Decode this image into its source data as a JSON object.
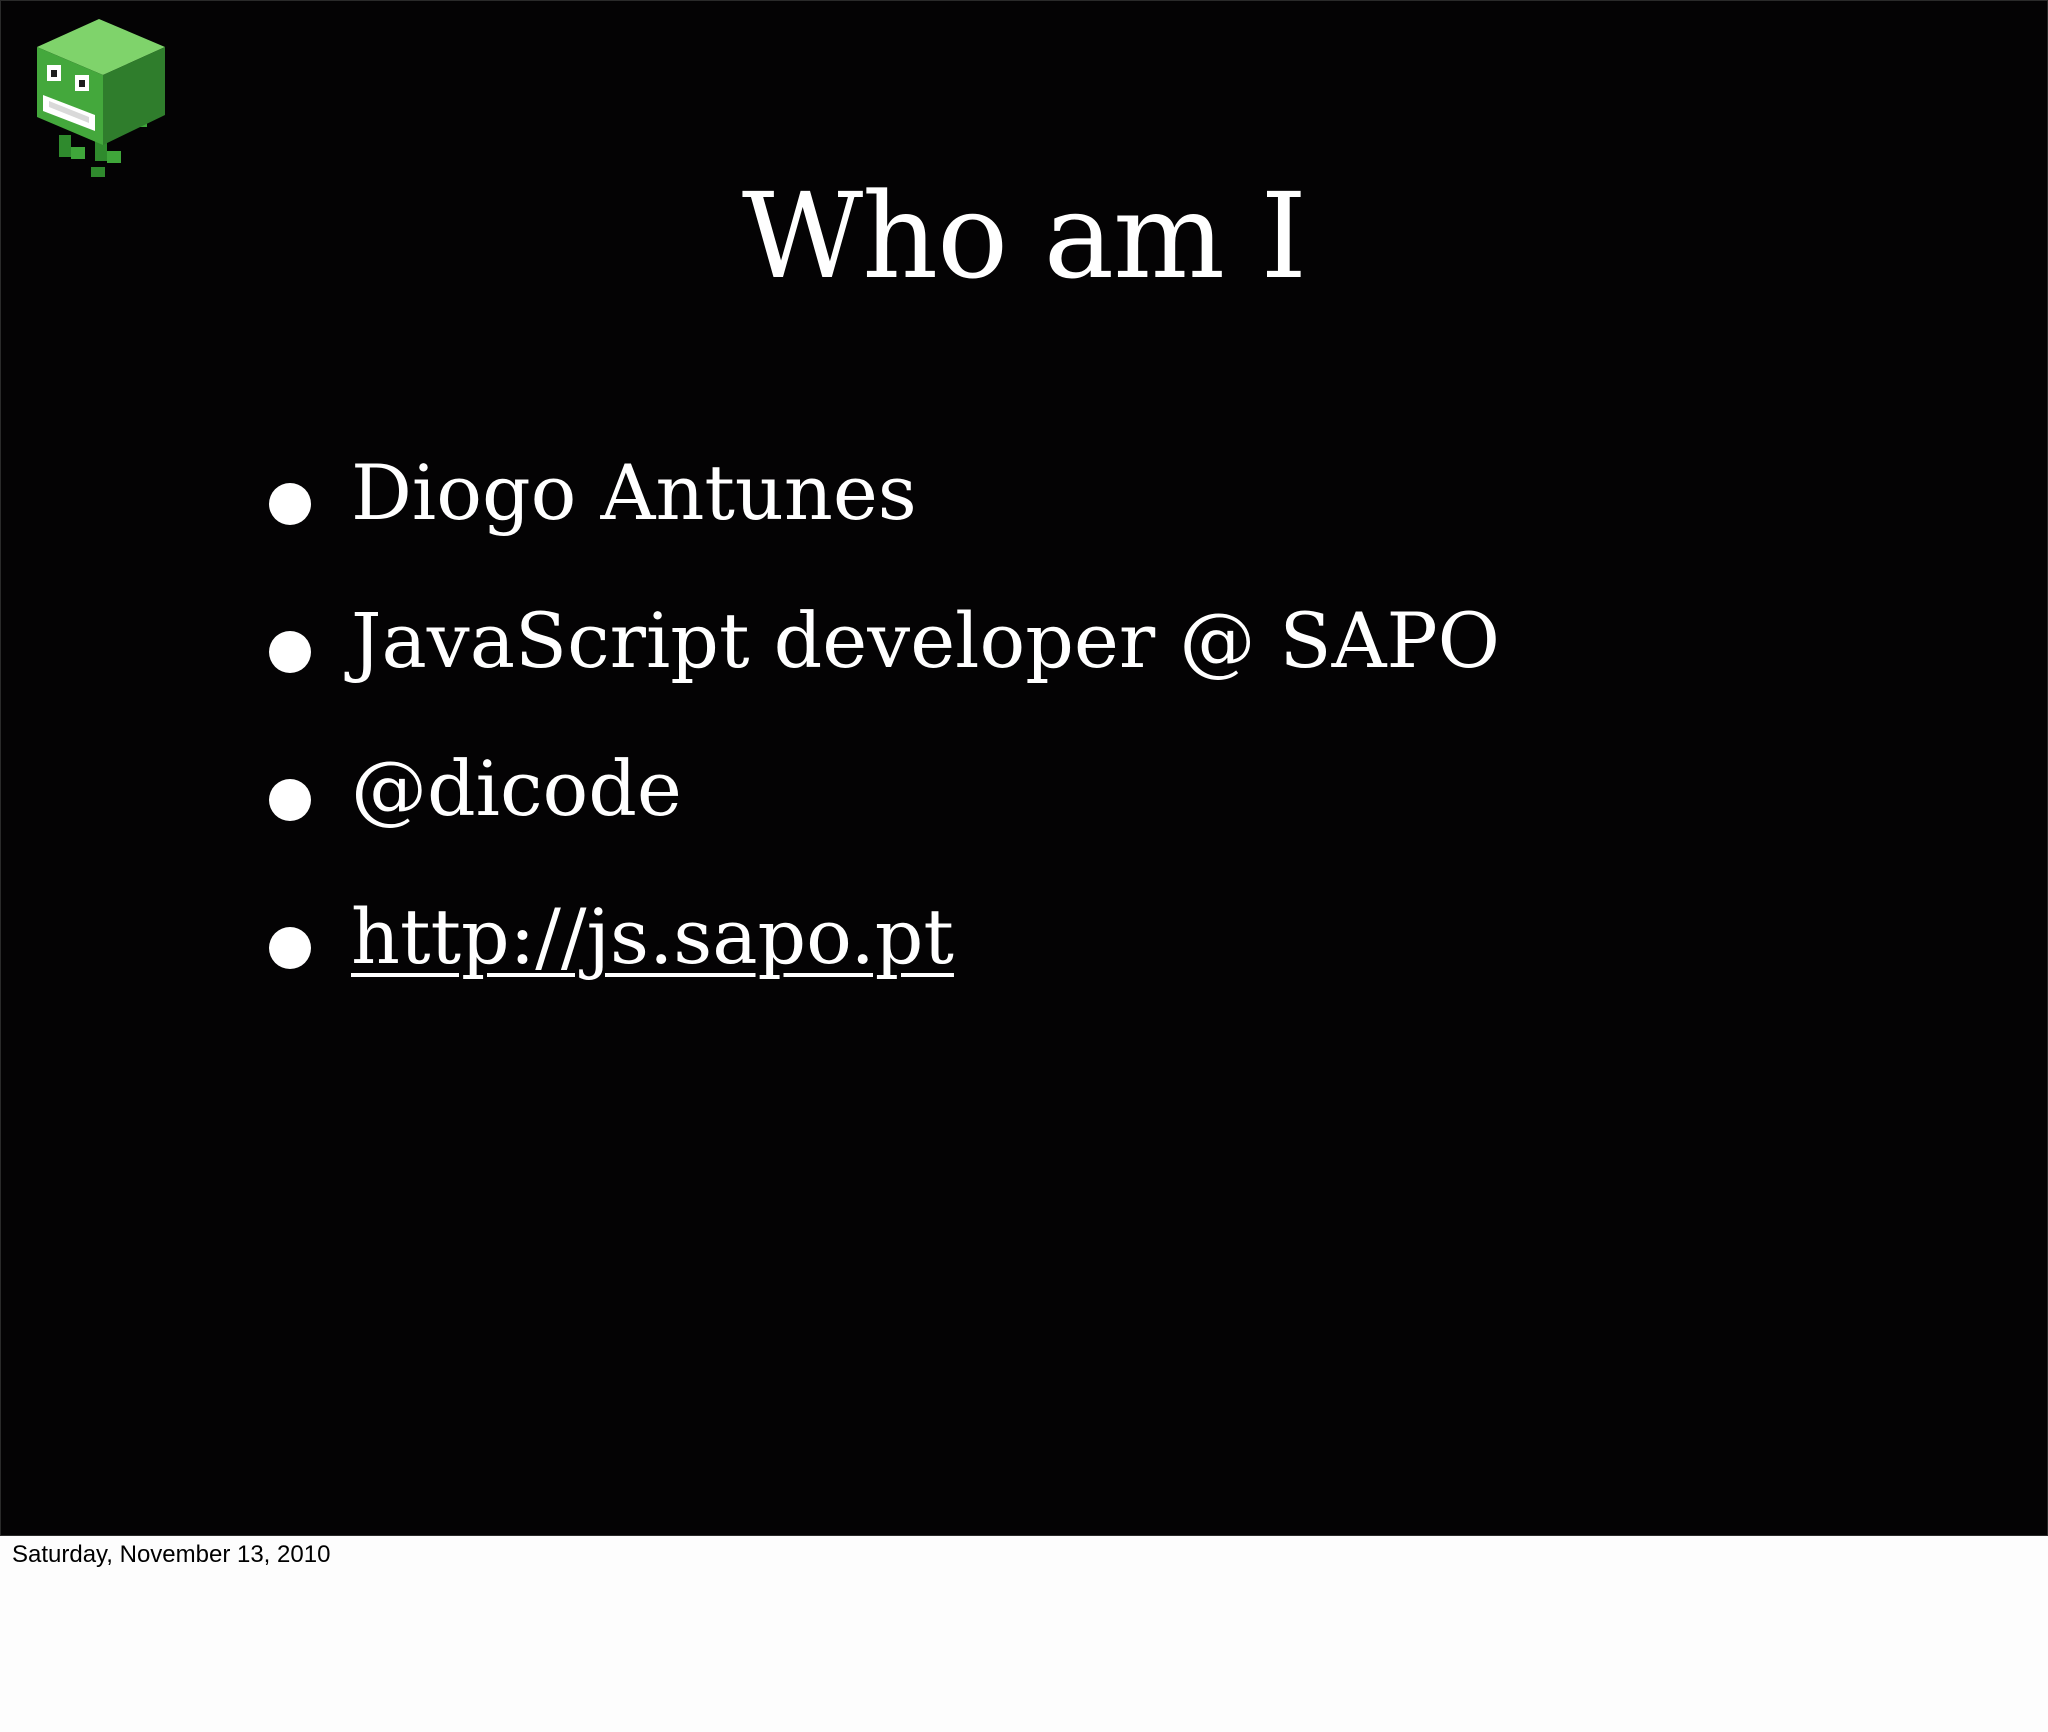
{
  "slide": {
    "logo_icon": "green-cube-monster-icon",
    "title": "Who am I",
    "bullets": [
      {
        "text": "Diogo Antunes",
        "is_link": false
      },
      {
        "text": "JavaScript developer @ SAPO",
        "is_link": false
      },
      {
        "text": "@dicode",
        "is_link": false
      },
      {
        "text": "http://js.sapo.pt",
        "is_link": true
      }
    ]
  },
  "footer": {
    "date": "Saturday, November 13, 2010"
  },
  "colors": {
    "slide_background": "#040304",
    "text": "#ffffff",
    "page_background": "#fdfdfd",
    "logo_green": "#3fa63a"
  }
}
